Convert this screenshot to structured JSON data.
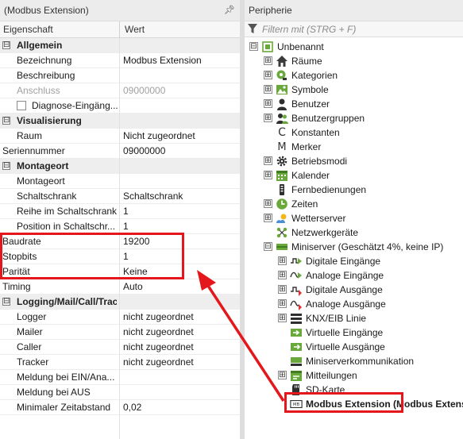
{
  "left_panel": {
    "title": "(Modbus Extension)",
    "pin_icon": "pin-icon",
    "col_property": "Eigenschaft",
    "col_value": "Wert",
    "rows": [
      {
        "type": "section",
        "expander": "⊟",
        "label": "Allgemein"
      },
      {
        "type": "prop",
        "label": "Bezeichnung",
        "value": "Modbus Extension"
      },
      {
        "type": "prop",
        "label": "Beschreibung",
        "value": ""
      },
      {
        "type": "prop",
        "label": "Anschluss",
        "value": "09000000",
        "dim": true
      },
      {
        "type": "checkbox",
        "label": "Diagnose-Eingäng..."
      },
      {
        "type": "section",
        "expander": "⊟",
        "label": "Visualisierung"
      },
      {
        "type": "prop",
        "label": "Raum",
        "value": "Nicht zugeordnet"
      },
      {
        "type": "prop0",
        "label": "Seriennummer",
        "value": "09000000"
      },
      {
        "type": "section",
        "expander": "⊟",
        "label": "Montageort"
      },
      {
        "type": "prop",
        "label": "Montageort",
        "value": ""
      },
      {
        "type": "prop",
        "label": "Schaltschrank",
        "value": "Schaltschrank"
      },
      {
        "type": "prop",
        "label": "Reihe im Schaltschrank",
        "value": "1"
      },
      {
        "type": "prop",
        "label": "Position in Schaltschr...",
        "value": "1"
      },
      {
        "type": "prop0",
        "label": "Baudrate",
        "value": "19200"
      },
      {
        "type": "prop0",
        "label": "Stopbits",
        "value": "1"
      },
      {
        "type": "prop0",
        "label": "Parität",
        "value": "Keine"
      },
      {
        "type": "prop0",
        "label": "Timing",
        "value": "Auto"
      },
      {
        "type": "section",
        "expander": "⊟",
        "label": "Logging/Mail/Call/Track"
      },
      {
        "type": "prop",
        "label": "Logger",
        "value": "nicht zugeordnet"
      },
      {
        "type": "prop",
        "label": "Mailer",
        "value": "nicht zugeordnet"
      },
      {
        "type": "prop",
        "label": "Caller",
        "value": "nicht zugeordnet"
      },
      {
        "type": "prop",
        "label": "Tracker",
        "value": "nicht zugeordnet"
      },
      {
        "type": "prop",
        "label": "Meldung bei EIN/Ana...",
        "value": ""
      },
      {
        "type": "prop",
        "label": "Meldung bei AUS",
        "value": ""
      },
      {
        "type": "prop",
        "label": "Minimaler Zeitabstand",
        "value": "0,02"
      }
    ]
  },
  "right_panel": {
    "title": "Peripherie",
    "filter_icon": "filter-icon",
    "filter_placeholder": "Filtern mit (STRG + F)",
    "tree": [
      {
        "level": 0,
        "expander": "⊟",
        "icon": "project-icon",
        "label": "Unbenannt"
      },
      {
        "level": 1,
        "expander": "⊞",
        "icon": "home-icon",
        "label": "Räume"
      },
      {
        "level": 1,
        "expander": "⊞",
        "icon": "category-icon",
        "label": "Kategorien"
      },
      {
        "level": 1,
        "expander": "⊞",
        "icon": "image-icon",
        "label": "Symbole"
      },
      {
        "level": 1,
        "expander": "⊞",
        "icon": "user-icon",
        "label": "Benutzer"
      },
      {
        "level": 1,
        "expander": "⊞",
        "icon": "users-icon",
        "label": "Benutzergruppen"
      },
      {
        "level": 1,
        "expander": "",
        "icon": "constant-icon",
        "label": "Konstanten"
      },
      {
        "level": 1,
        "expander": "",
        "icon": "memory-icon",
        "label": "Merker"
      },
      {
        "level": 1,
        "expander": "⊞",
        "icon": "gear-icon",
        "label": "Betriebsmodi"
      },
      {
        "level": 1,
        "expander": "⊞",
        "icon": "calendar-icon",
        "label": "Kalender"
      },
      {
        "level": 1,
        "expander": "",
        "icon": "remote-icon",
        "label": "Fernbedienungen"
      },
      {
        "level": 1,
        "expander": "⊞",
        "icon": "clock-icon",
        "label": "Zeiten"
      },
      {
        "level": 1,
        "expander": "⊞",
        "icon": "weather-icon",
        "label": "Wetterserver"
      },
      {
        "level": 1,
        "expander": "",
        "icon": "network-icon",
        "label": "Netzwerkgeräte"
      },
      {
        "level": 1,
        "expander": "⊟",
        "icon": "miniserver-icon",
        "label": "Miniserver (Geschätzt 4%, keine IP)"
      },
      {
        "level": 2,
        "expander": "⊞",
        "icon": "digital-input-icon",
        "label": "Digitale Eingänge"
      },
      {
        "level": 2,
        "expander": "⊞",
        "icon": "analog-input-icon",
        "label": "Analoge Eingänge"
      },
      {
        "level": 2,
        "expander": "⊞",
        "icon": "digital-output-icon",
        "label": "Digitale Ausgänge"
      },
      {
        "level": 2,
        "expander": "⊞",
        "icon": "analog-output-icon",
        "label": "Analoge Ausgänge"
      },
      {
        "level": 2,
        "expander": "⊞",
        "icon": "knx-icon",
        "label": "KNX/EIB Linie"
      },
      {
        "level": 2,
        "expander": "",
        "icon": "virtual-input-icon",
        "label": "Virtuelle Eingänge"
      },
      {
        "level": 2,
        "expander": "",
        "icon": "virtual-output-icon",
        "label": "Virtuelle Ausgänge"
      },
      {
        "level": 2,
        "expander": "",
        "icon": "communication-icon",
        "label": "Miniserverkommunikation"
      },
      {
        "level": 2,
        "expander": "⊞",
        "icon": "message-icon",
        "label": "Mitteilungen"
      },
      {
        "level": 2,
        "expander": "",
        "icon": "sdcard-icon",
        "label": "SD-Karte"
      },
      {
        "level": 2,
        "expander": "",
        "icon": "modbus-extension-icon",
        "label": "Modbus Extension (Modbus Extension)",
        "selected": true
      }
    ]
  },
  "annotations": {
    "highlight_color": "#e3171c"
  }
}
